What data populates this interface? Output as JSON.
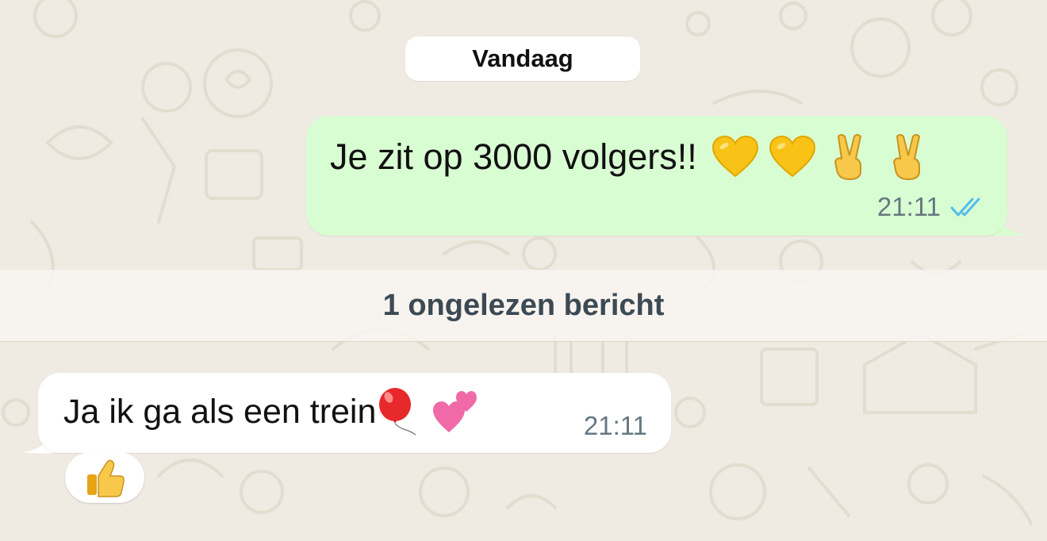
{
  "chat": {
    "date_label": "Vandaag",
    "unread_label": "1 ongelezen bericht",
    "messages": [
      {
        "direction": "outgoing",
        "text": "Je zit op 3000 volgers!!",
        "emojis": [
          "yellow-heart-icon",
          "yellow-heart-icon",
          "victory-hand-icon",
          "victory-hand-icon"
        ],
        "time": "21:11",
        "status": "read"
      },
      {
        "direction": "incoming",
        "text": "Ja ik ga als een trein",
        "emojis": [
          "balloon-icon",
          "two-hearts-icon"
        ],
        "time": "21:11",
        "reaction": "thumbs-up-icon"
      }
    ]
  },
  "colors": {
    "wallpaper": "#efeae2",
    "outgoing_bubble": "#d9fdd3",
    "incoming_bubble": "#ffffff",
    "read_ticks": "#53bdeb",
    "timestamp": "#667781"
  }
}
